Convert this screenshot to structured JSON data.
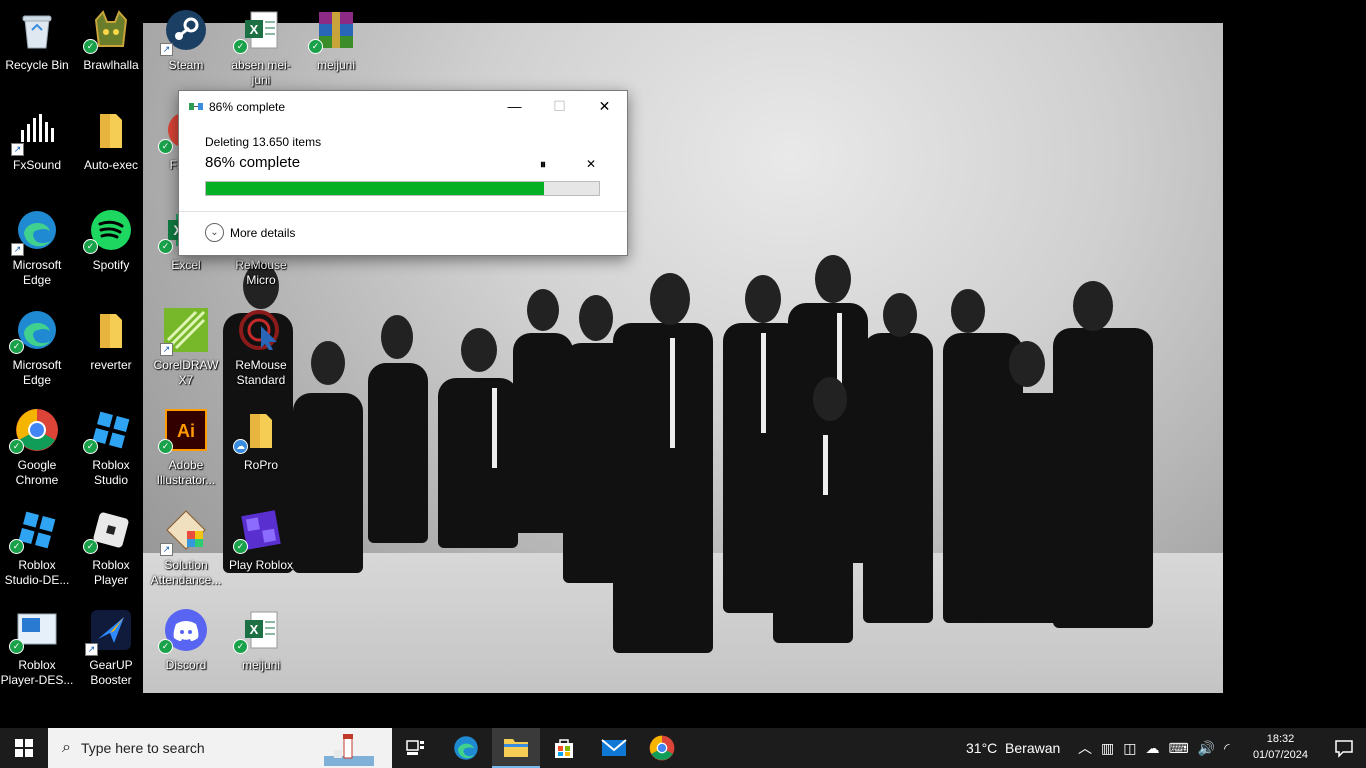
{
  "desktop_icons": [
    {
      "label": "Recycle Bin",
      "icon": "recycle-bin-icon"
    },
    {
      "label": "Brawlhalla",
      "icon": "brawlhalla-icon"
    },
    {
      "label": "Steam",
      "icon": "steam-icon"
    },
    {
      "label": "absen mei-juni",
      "icon": "excel-file-icon"
    },
    {
      "label": "meijuni",
      "icon": "winrar-icon"
    },
    {
      "label": "FxSound",
      "icon": "fxsound-icon"
    },
    {
      "label": "Auto-exec",
      "icon": "folder-icon"
    },
    {
      "label": "Fa Ch",
      "icon": "chrome-app-icon"
    },
    {
      "label": "Microsoft Edge",
      "icon": "edge-icon"
    },
    {
      "label": "Spotify",
      "icon": "spotify-icon"
    },
    {
      "label": "Excel",
      "icon": "excel-icon"
    },
    {
      "label": "ReMouse Micro",
      "icon": "remouse-icon"
    },
    {
      "label": "Microsoft Edge",
      "icon": "edge-icon"
    },
    {
      "label": "reverter",
      "icon": "folder-icon"
    },
    {
      "label": "CorelDRAW X7",
      "icon": "coreldraw-icon"
    },
    {
      "label": "ReMouse Standard",
      "icon": "remouse-icon"
    },
    {
      "label": "Google Chrome",
      "icon": "chrome-icon"
    },
    {
      "label": "Roblox Studio",
      "icon": "roblox-studio-icon"
    },
    {
      "label": "Adobe Illustrator...",
      "icon": "illustrator-icon"
    },
    {
      "label": "RoPro",
      "icon": "folder-icon"
    },
    {
      "label": "Roblox Studio-DE...",
      "icon": "roblox-studio-icon"
    },
    {
      "label": "Roblox Player",
      "icon": "roblox-player-icon"
    },
    {
      "label": "Solution Attendance...",
      "icon": "solution-icon"
    },
    {
      "label": "Play Roblox",
      "icon": "play-roblox-icon"
    },
    {
      "label": "Roblox Player-DES...",
      "icon": "roblox-player-icon"
    },
    {
      "label": "GearUP Booster",
      "icon": "gearup-icon"
    },
    {
      "label": "Discord",
      "icon": "discord-icon"
    },
    {
      "label": "meijuni",
      "icon": "excel-file-icon"
    }
  ],
  "dialog": {
    "title": "86% complete",
    "subtitle": "Deleting 13.650 items",
    "progress_text": "86% complete",
    "progress": 0.86,
    "more_details": "More details",
    "minimize": "—",
    "maximize": "☐",
    "close": "✕",
    "pause": "⏸",
    "cancel": "✕"
  },
  "taskbar": {
    "search_placeholder": "Type here to search",
    "weather": "31°C  Berawan",
    "time": "18:32",
    "date": "01/07/2024",
    "apps": [
      "task-view-icon",
      "edge-icon",
      "file-explorer-icon",
      "microsoft-store-icon",
      "mail-icon",
      "chrome-icon"
    ]
  },
  "colors": {
    "progress": "#06b025",
    "taskbar": "#1c1c1c",
    "accent": "#76b9ed"
  }
}
